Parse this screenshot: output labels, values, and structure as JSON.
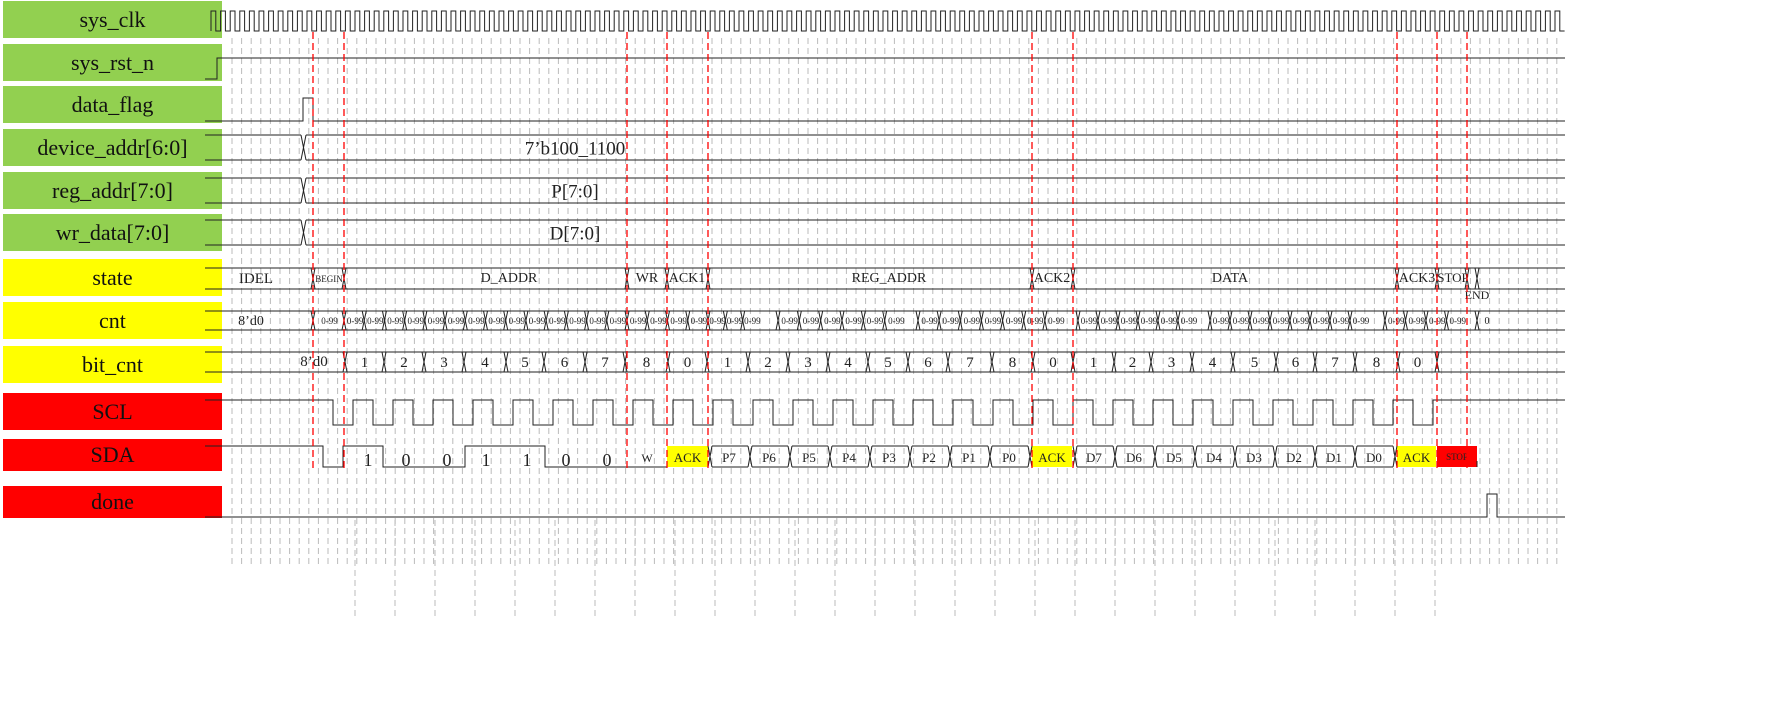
{
  "colors": {
    "signal": "#92D050",
    "control": "#FFFF00",
    "bus": "#FF0000",
    "marker": "#FF0000",
    "grid": "#BBBBBB",
    "ack": "#FFFF00",
    "stop": "#FF0000"
  },
  "signals": [
    {
      "label": "sys_clk",
      "group": "signal"
    },
    {
      "label": "sys_rst_n",
      "group": "signal"
    },
    {
      "label": "data_flag",
      "group": "signal"
    },
    {
      "label": "device_addr[6:0]",
      "group": "signal"
    },
    {
      "label": "reg_addr[7:0]",
      "group": "signal"
    },
    {
      "label": "wr_data[7:0]",
      "group": "signal"
    },
    {
      "label": "state",
      "group": "control"
    },
    {
      "label": "cnt",
      "group": "control"
    },
    {
      "label": "bit_cnt",
      "group": "control"
    },
    {
      "label": "SCL",
      "group": "bus"
    },
    {
      "label": "SDA",
      "group": "bus"
    },
    {
      "label": "done",
      "group": "bus"
    }
  ],
  "buses": {
    "device_addr": "7’b100_1100",
    "reg_addr": "P[7:0]",
    "wr_data": "D[7:0]"
  },
  "state": {
    "initial": "IDEL",
    "phases": [
      "BEGIN",
      "D_ADDR",
      "WR",
      "ACK1",
      "REG_ADDR",
      "ACK2",
      "DATA",
      "ACK3",
      "STOP"
    ],
    "final": "END"
  },
  "cnt": {
    "initial": "8’d0",
    "cycle_label": "0-99",
    "final": "0"
  },
  "bit_cnt": {
    "initial": "8’d0",
    "d_addr": [
      "1",
      "2",
      "3",
      "4",
      "5",
      "6",
      "7"
    ],
    "wr": "8",
    "ack1": "0",
    "reg_addr": [
      "1",
      "2",
      "3",
      "4",
      "5",
      "6",
      "7",
      "8"
    ],
    "ack2": "0",
    "data": [
      "1",
      "2",
      "3",
      "4",
      "5",
      "6",
      "7",
      "8"
    ],
    "ack3": "0"
  },
  "sda": {
    "device_bits": [
      "1",
      "0",
      "0",
      "1",
      "1",
      "0",
      "0"
    ],
    "wr": "W",
    "ack": "ACK",
    "reg_bits": [
      "P7",
      "P6",
      "P5",
      "P4",
      "P3",
      "P2",
      "P1",
      "P0"
    ],
    "data_bits": [
      "D7",
      "D6",
      "D5",
      "D4",
      "D3",
      "D2",
      "D1",
      "D0"
    ],
    "stop": "STOP"
  }
}
